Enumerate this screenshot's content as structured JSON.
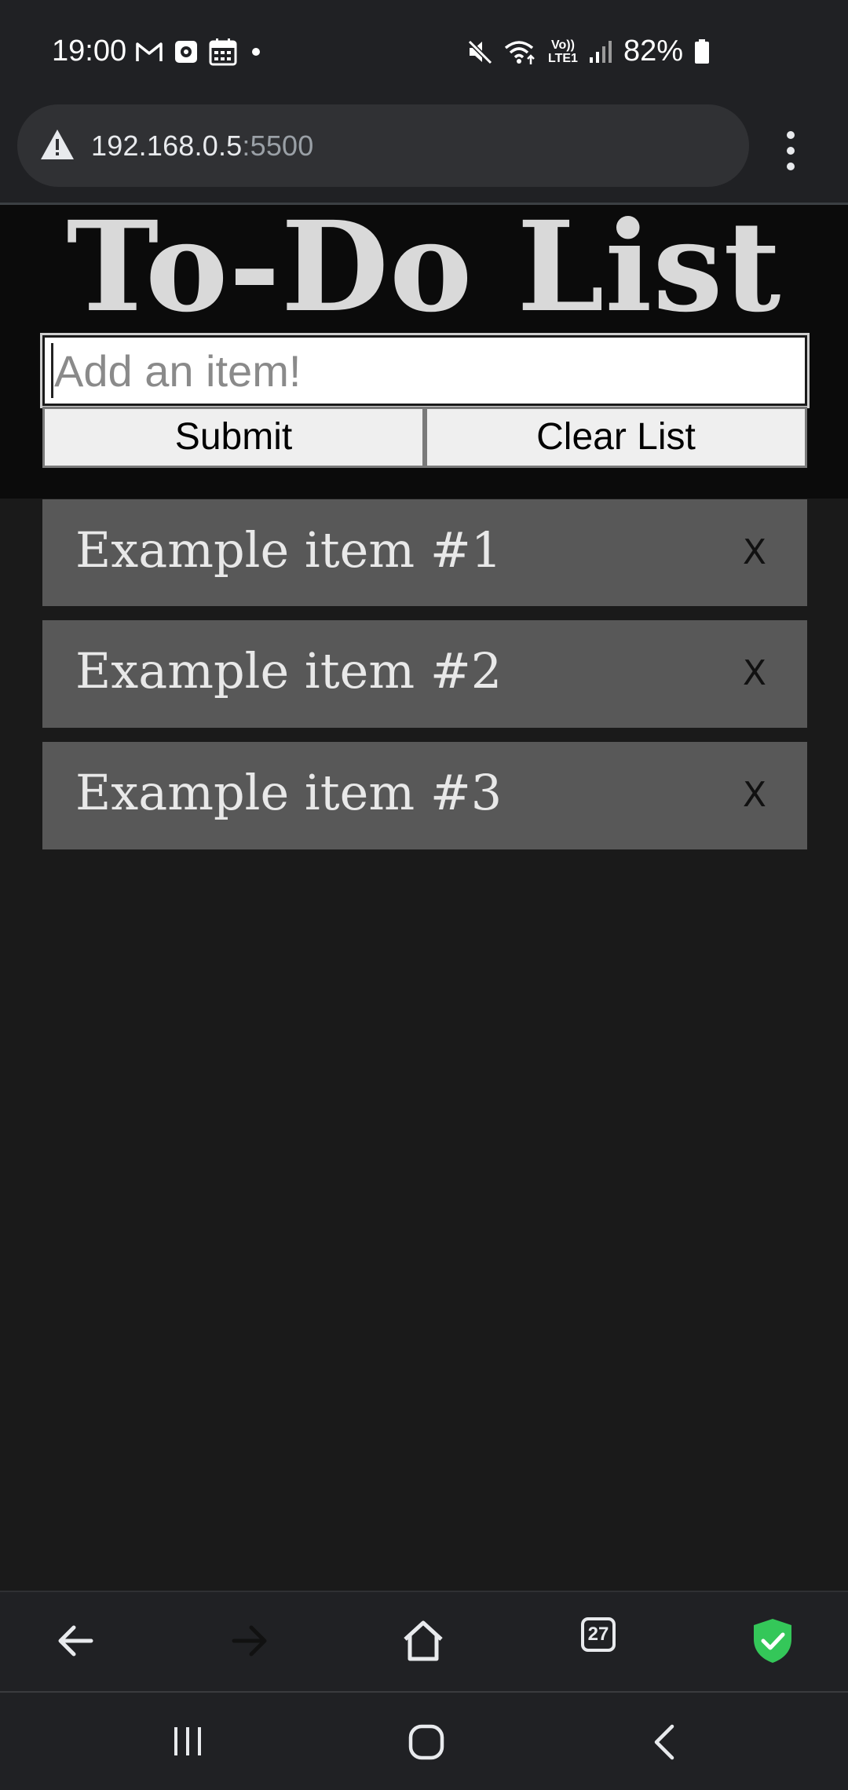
{
  "status_bar": {
    "time": "19:00",
    "battery_percent": "82%",
    "left_icons": [
      "gmail-icon",
      "app-notification-icon",
      "calendar-icon",
      "dot-icon"
    ],
    "right_icons": [
      "mute-icon",
      "wifi-icon",
      "volte-icon",
      "signal-icon",
      "battery-icon"
    ],
    "volte_label_top": "Vo))",
    "volte_label_bottom": "LTE1"
  },
  "browser": {
    "url_host": "192.168.0.5",
    "url_port": ":5500",
    "security_icon": "warning-icon",
    "tab_count": "27"
  },
  "page": {
    "title": "To-Do List",
    "input_placeholder": "Add an item!",
    "input_value": "",
    "submit_label": "Submit",
    "clear_label": "Clear List",
    "items": [
      {
        "text": "Example item #1",
        "remove_label": "X"
      },
      {
        "text": "Example item #2",
        "remove_label": "X"
      },
      {
        "text": "Example item #3",
        "remove_label": "X"
      }
    ]
  },
  "colors": {
    "page_background": "#1a1a1a",
    "header_background": "#0b0b0b",
    "item_background": "#585858",
    "title_color": "#d9d9d9",
    "chrome_background": "#202124",
    "shield_green": "#34c759"
  }
}
